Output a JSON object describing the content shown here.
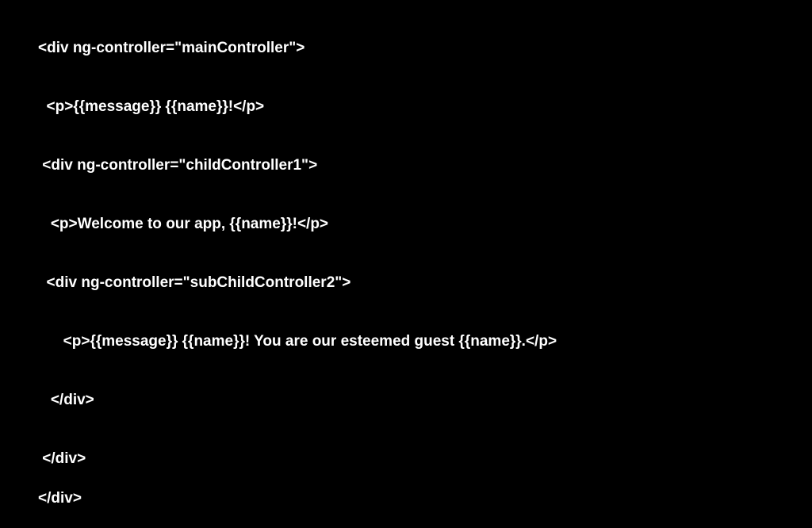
{
  "code": {
    "l1": "<div ng-controller=\"mainController\">",
    "l2": "  <p>{{message}} {{name}}!</p>",
    "l3": " <div ng-controller=\"childController1\">",
    "l4": "   <p>Welcome to our app, {{name}}!</p>",
    "l5": "  <div ng-controller=\"subChildController2\">",
    "l6": "      <p>{{message}} {{name}}! You are our esteemed guest {{name}}.</p>",
    "l7": "   </div>",
    "l8": " </div>",
    "l9": "</div>"
  }
}
